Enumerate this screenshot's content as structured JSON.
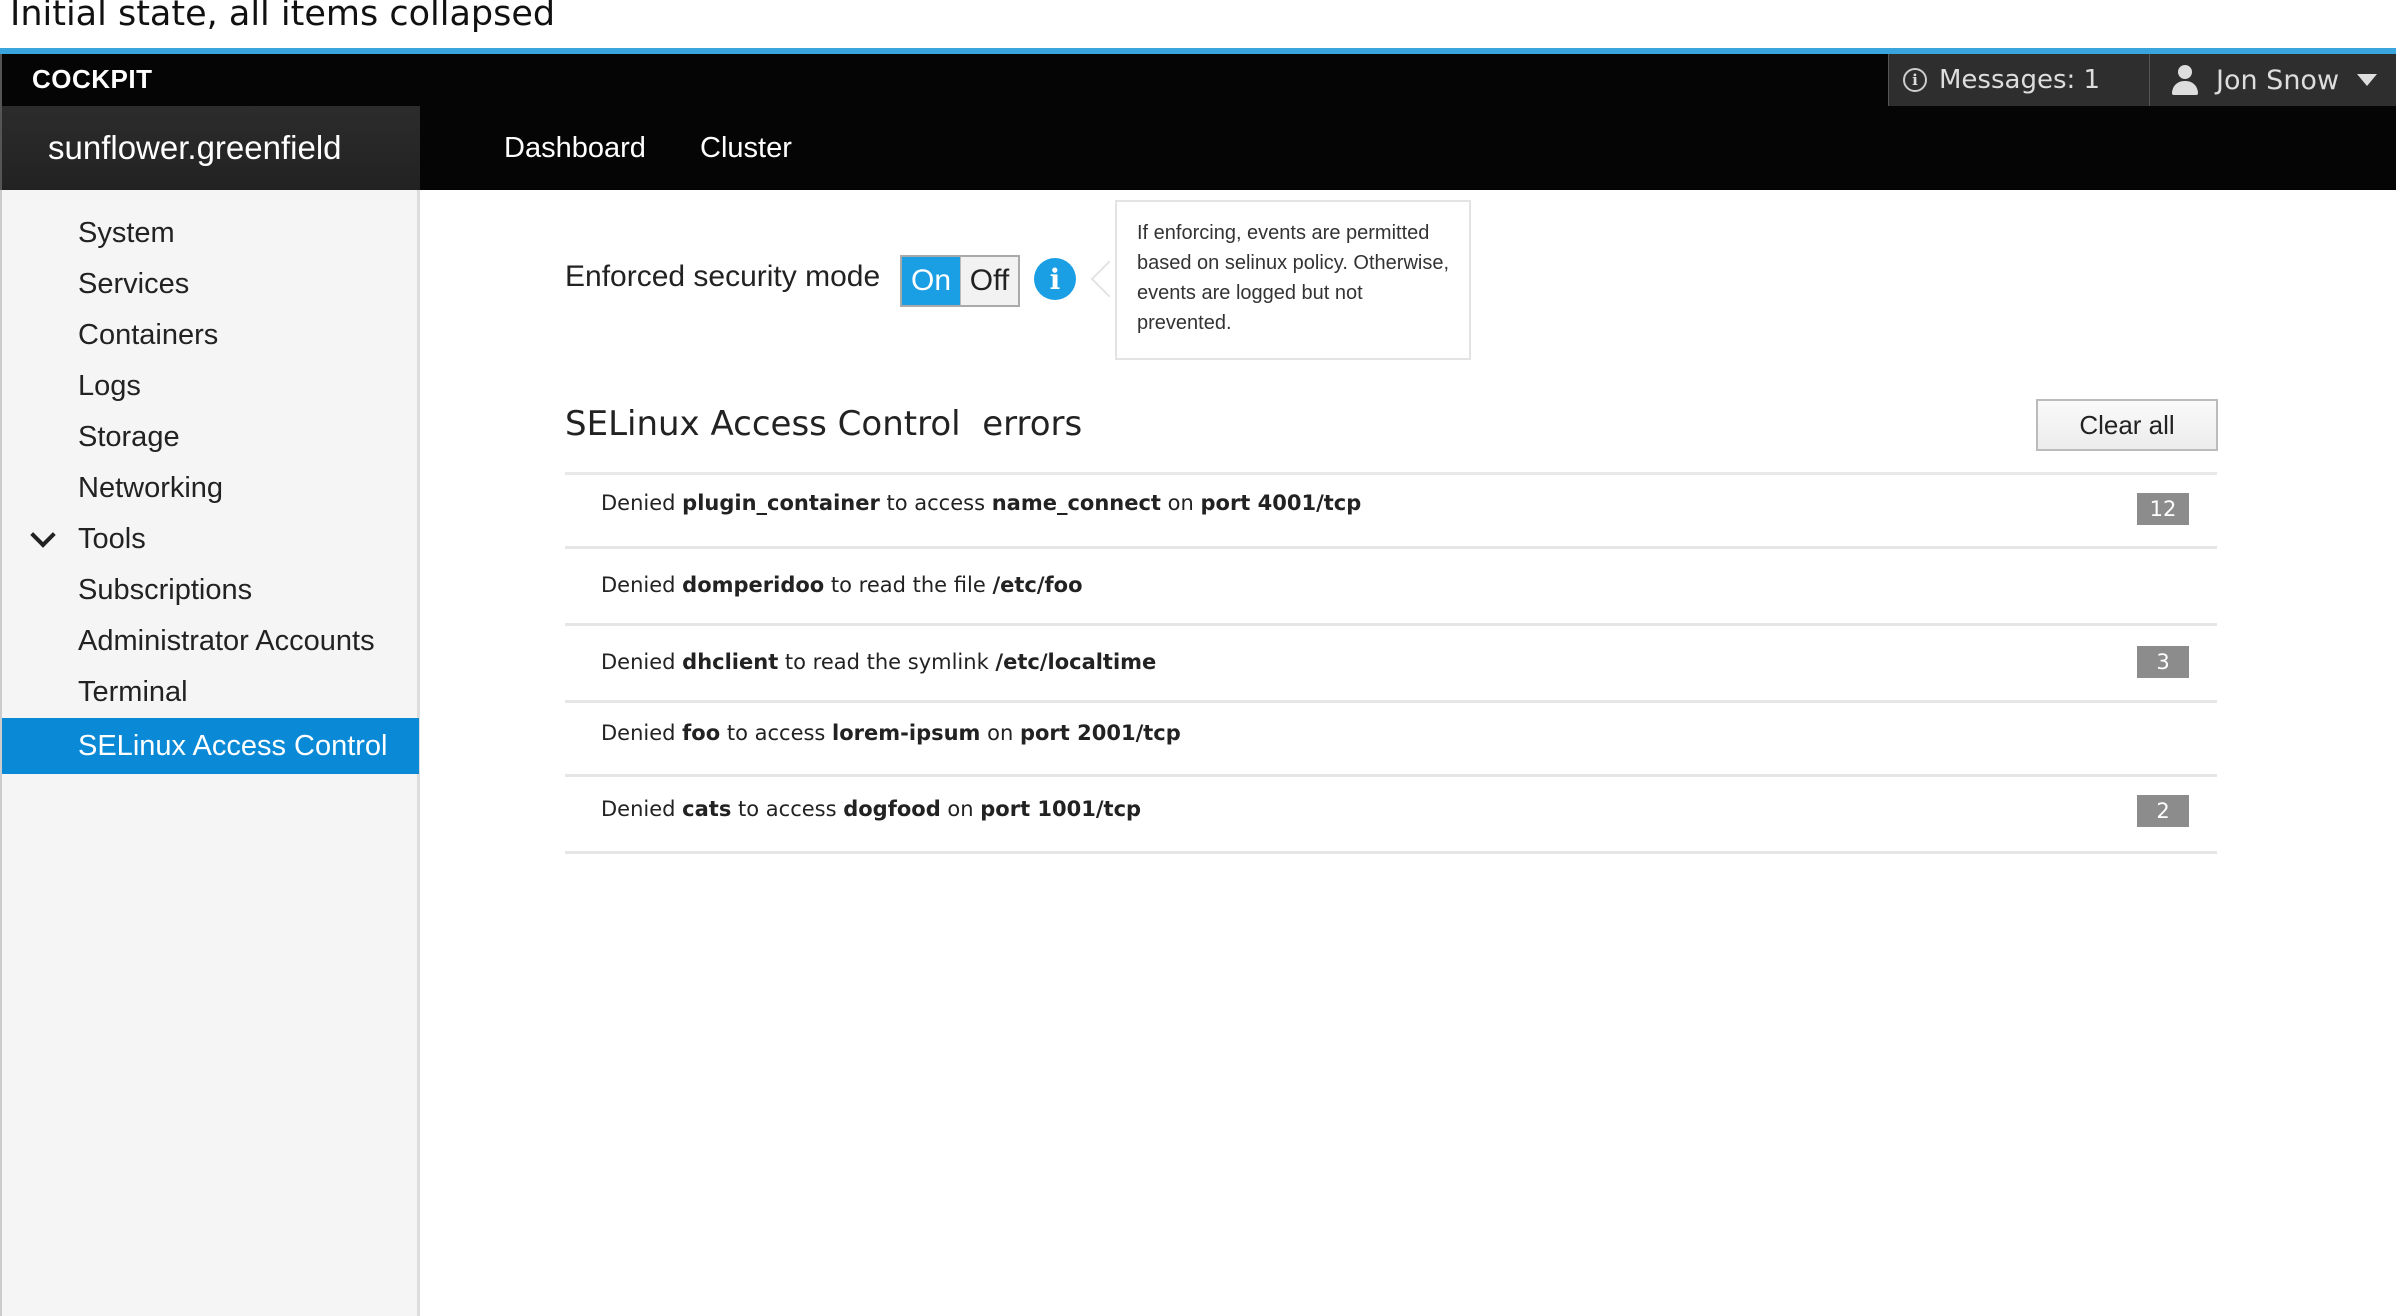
{
  "caption": "Initial state, all items collapsed",
  "topbar": {
    "brand": "COCKPIT",
    "messages_label": "Messages: 1",
    "messages_icon": "info-circle-icon",
    "user_name": "Jon Snow",
    "user_icon": "user-icon"
  },
  "navbar": {
    "host": "sunflower.greenfield",
    "links": [
      "Dashboard",
      "Cluster"
    ]
  },
  "sidebar": {
    "items": [
      {
        "label": "System"
      },
      {
        "label": "Services"
      },
      {
        "label": "Containers"
      },
      {
        "label": "Logs"
      },
      {
        "label": "Storage"
      },
      {
        "label": "Networking"
      },
      {
        "label": "Tools",
        "expanded": true
      },
      {
        "label": "Subscriptions"
      },
      {
        "label": "Administrator Accounts"
      },
      {
        "label": "Terminal"
      },
      {
        "label": "SELinux Access Control",
        "active": true
      }
    ]
  },
  "main": {
    "enforce_label": "Enforced security mode",
    "toggle": {
      "on_label": "On",
      "off_label": "Off",
      "state": "on"
    },
    "tooltip": "If enforcing, events are permitted based on selinux policy. Otherwise, events are logged but not prevented.",
    "section_title": "SELinux Access Control  errors",
    "clear_button": "Clear all",
    "errors": [
      {
        "parts": [
          [
            "Denied ",
            false
          ],
          [
            "plugin_container",
            true
          ],
          [
            " to access ",
            false
          ],
          [
            "name_connect",
            true
          ],
          [
            " on ",
            false
          ],
          [
            "port 4001/tcp",
            true
          ]
        ],
        "count": "12"
      },
      {
        "parts": [
          [
            "Denied ",
            false
          ],
          [
            "domperidoo",
            true
          ],
          [
            " to read the file ",
            false
          ],
          [
            "/etc/foo",
            true
          ]
        ],
        "count": ""
      },
      {
        "parts": [
          [
            "Denied ",
            false
          ],
          [
            "dhclient",
            true
          ],
          [
            " to read the symlink ",
            false
          ],
          [
            "/etc/localtime",
            true
          ]
        ],
        "count": "3"
      },
      {
        "parts": [
          [
            "Denied ",
            false
          ],
          [
            "foo",
            true
          ],
          [
            " to access ",
            false
          ],
          [
            "lorem-ipsum",
            true
          ],
          [
            " on ",
            false
          ],
          [
            "port 2001/tcp",
            true
          ]
        ],
        "count": ""
      },
      {
        "parts": [
          [
            "Denied ",
            false
          ],
          [
            "cats",
            true
          ],
          [
            " to access ",
            false
          ],
          [
            "dogfood",
            true
          ],
          [
            " on ",
            false
          ],
          [
            "port 1001/tcp",
            true
          ]
        ],
        "count": "2"
      }
    ]
  },
  "colors": {
    "accent": "#1a9ee4",
    "active_item": "#0a8ad6",
    "topbar": "#050505",
    "badge": "#8c8c8c"
  }
}
